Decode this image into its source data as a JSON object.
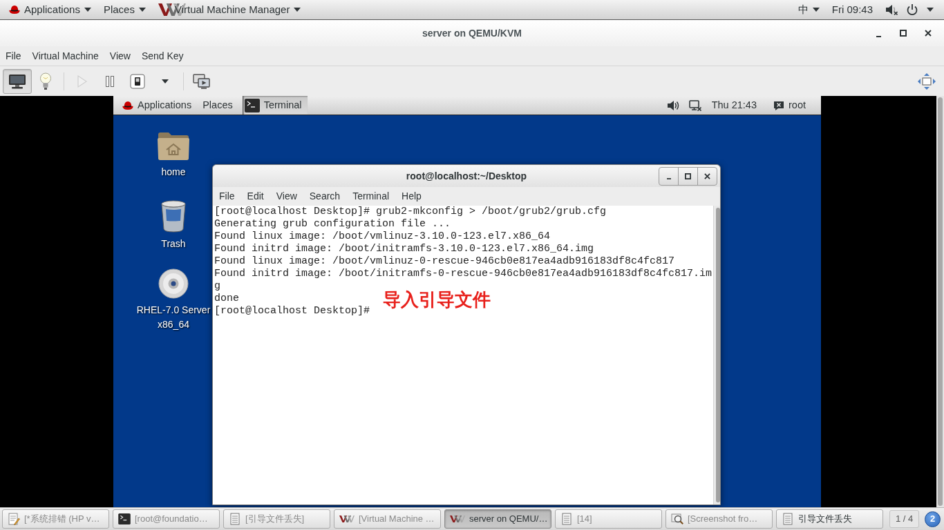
{
  "top_panel": {
    "menus": [
      {
        "kind": "distro",
        "label": "Applications"
      },
      {
        "kind": "places",
        "label": "Places"
      },
      {
        "kind": "app",
        "label": "Virtual Machine Manager"
      }
    ],
    "input_method": "中",
    "clock": "Fri 09:43",
    "volume_muted": true
  },
  "window": {
    "title": "server on QEMU/KVM",
    "menu": [
      "File",
      "Virtual Machine",
      "View",
      "Send Key"
    ],
    "toolbar": [
      {
        "kind": "console",
        "selected": true
      },
      {
        "kind": "details",
        "selected": false
      },
      {
        "kind": "separator"
      },
      {
        "kind": "run",
        "disabled": true
      },
      {
        "kind": "pause",
        "disabled": false
      },
      {
        "kind": "shutdown",
        "disabled": false
      },
      {
        "kind": "dropdown",
        "disabled": false
      },
      {
        "kind": "separator"
      },
      {
        "kind": "snapshots",
        "disabled": false
      },
      {
        "kind": "fullscreen",
        "disabled": false
      }
    ]
  },
  "guest": {
    "panel": {
      "menus": [
        {
          "kind": "distro",
          "label": "Applications"
        },
        {
          "kind": "places",
          "label": "Places"
        }
      ],
      "task": {
        "label": "Terminal",
        "selected": true
      },
      "volume_muted": false,
      "network_connected": false,
      "clock": "Thu 21:43",
      "user": "root"
    },
    "desktop_icons": [
      {
        "kind": "home",
        "label": "home"
      },
      {
        "kind": "trash",
        "label": "Trash"
      },
      {
        "kind": "dvd",
        "label": "RHEL-7.0 Server x86_64"
      }
    ],
    "terminal": {
      "title": "root@localhost:~/Desktop",
      "menu": [
        "File",
        "Edit",
        "View",
        "Search",
        "Terminal",
        "Help"
      ],
      "lines": [
        "[root@localhost Desktop]# grub2-mkconfig > /boot/grub2/grub.cfg",
        "Generating grub configuration file ...",
        "Found linux image: /boot/vmlinuz-3.10.0-123.el7.x86_64",
        "Found initrd image: /boot/initramfs-3.10.0-123.el7.x86_64.img",
        "Found linux image: /boot/vmlinuz-0-rescue-946cb0e817ea4adb916183df8c4fc817",
        "Found initrd image: /boot/initramfs-0-rescue-946cb0e817ea4adb916183df8c4fc817.im",
        "g",
        "done",
        "[root@localhost Desktop]#"
      ],
      "annotation": "导入引导文件"
    }
  },
  "taskbar": {
    "items": [
      {
        "kind": "editor",
        "label": "[*系统排错 (HP v…",
        "selected": false,
        "minimized": true
      },
      {
        "kind": "terminal",
        "label": "[root@foundatio…",
        "selected": false,
        "minimized": true
      },
      {
        "kind": "document",
        "label": "[引导文件丢失]",
        "selected": false,
        "minimized": true
      },
      {
        "kind": "vmm",
        "label": "[Virtual Machine …",
        "selected": false,
        "minimized": true
      },
      {
        "kind": "vmm",
        "label": "server on QEMU/…",
        "selected": true,
        "minimized": false
      },
      {
        "kind": "document",
        "label": "[14]",
        "selected": false,
        "minimized": true
      },
      {
        "kind": "screenshot",
        "label": "[Screenshot fro…",
        "selected": false,
        "minimized": true
      },
      {
        "kind": "document",
        "label": "引导文件丢失",
        "selected": false,
        "minimized": false
      }
    ],
    "workspace": "1 / 4",
    "notifications": "2"
  }
}
